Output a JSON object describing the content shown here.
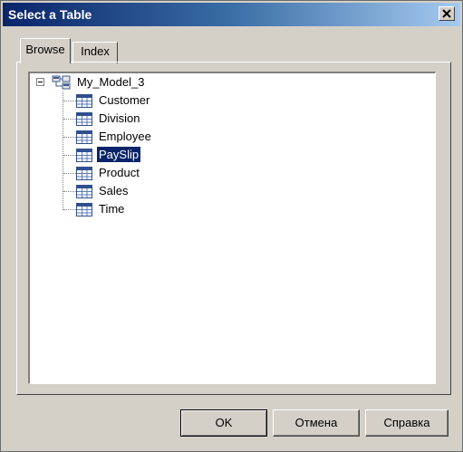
{
  "window": {
    "title": "Select a Table",
    "close_icon": "close-icon"
  },
  "tabs": [
    {
      "label": "Browse",
      "active": true
    },
    {
      "label": "Index",
      "active": false
    }
  ],
  "tree": {
    "root": {
      "label": "My_Model_3",
      "icon": "model-icon",
      "expanded": true
    },
    "items": [
      {
        "label": "Customer",
        "icon": "table-icon"
      },
      {
        "label": "Division",
        "icon": "table-icon"
      },
      {
        "label": "Employee",
        "icon": "table-icon"
      },
      {
        "label": "PaySlip",
        "icon": "table-icon",
        "selected": true
      },
      {
        "label": "Product",
        "icon": "table-icon"
      },
      {
        "label": "Sales",
        "icon": "table-icon"
      },
      {
        "label": "Time",
        "icon": "table-icon"
      }
    ]
  },
  "buttons": {
    "ok": "OK",
    "cancel": "Отмена",
    "help": "Справка"
  },
  "colors": {
    "title_start": "#0a246a",
    "title_end": "#a6caf0",
    "face": "#d4d0c8",
    "selection": "#0a246a"
  }
}
